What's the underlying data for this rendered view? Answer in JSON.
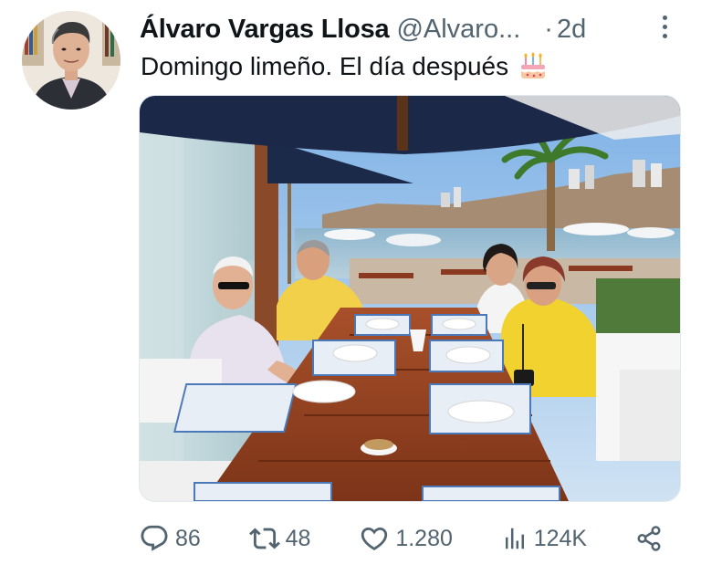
{
  "author": {
    "display_name": "Álvaro Vargas Llosa",
    "handle": "@Alvaro...",
    "separator": "·",
    "timestamp": "2d"
  },
  "tweet": {
    "text": "Domingo limeño. El día después",
    "emoji_icon": "birthday-cake-icon"
  },
  "actions": {
    "replies": "86",
    "retweets": "48",
    "likes": "1.280",
    "views": "124K",
    "reply_icon": "reply-icon",
    "retweet_icon": "retweet-icon",
    "like_icon": "heart-icon",
    "views_icon": "views-chart-icon",
    "share_icon": "share-icon"
  },
  "colors": {
    "text_primary": "#0f1419",
    "text_secondary": "#536471"
  }
}
